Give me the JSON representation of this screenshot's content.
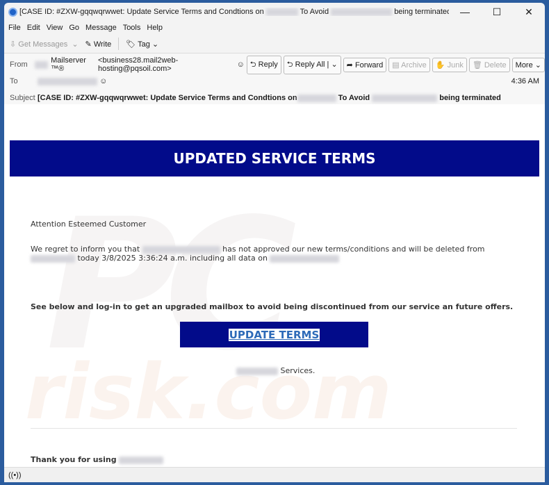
{
  "window": {
    "title_part1": "[CASE ID: #ZXW-gqqwqrwwet: Update Service Terms and Condtions on",
    "title_part2": "To Avoid",
    "title_part3": "being terminated - Mozilla ...",
    "minimize": "—",
    "maximize": "☐",
    "close": "✕"
  },
  "menu": [
    "File",
    "Edit",
    "View",
    "Go",
    "Message",
    "Tools",
    "Help"
  ],
  "toolbar": {
    "get_messages": "Get Messages",
    "write": "Write",
    "tag": "Tag"
  },
  "header": {
    "from_label": "From",
    "from_name": "Mailserver ™®",
    "from_email": "<business28.mail2web-hosting@pqsoil.com>",
    "to_label": "To",
    "time": "4:36 AM",
    "subject_label": "Subject",
    "subject_part1": "[CASE ID: #ZXW-gqqwqrwwet: Update Service Terms and Condtions on",
    "subject_part2": "To Avoid",
    "subject_part3": "being terminated",
    "buttons": {
      "reply": "Reply",
      "reply_all": "Reply All",
      "forward": "Forward",
      "archive": "Archive",
      "junk": "Junk",
      "delete": "Delete",
      "more": "More"
    }
  },
  "email": {
    "banner": "UPDATED SERVICE TERMS",
    "greeting": "Attention Esteemed Customer",
    "p1_a": "We regret to inform you  that",
    "p1_b": "has not approved our new terms/conditions and will be deleted from",
    "p1_c": "today 3/8/2025 3:36:24 a.m. including all data on",
    "p2": "See below and log-in to get an upgraded mailbox to avoid being discontinued from our service an future offers.",
    "cta": "UPDATE TERMS",
    "services": "Services.",
    "thanks": "Thank you for using"
  },
  "colors": {
    "banner": "#020b8a",
    "link": "#2d6ab8",
    "frame": "#2b5c9e"
  }
}
